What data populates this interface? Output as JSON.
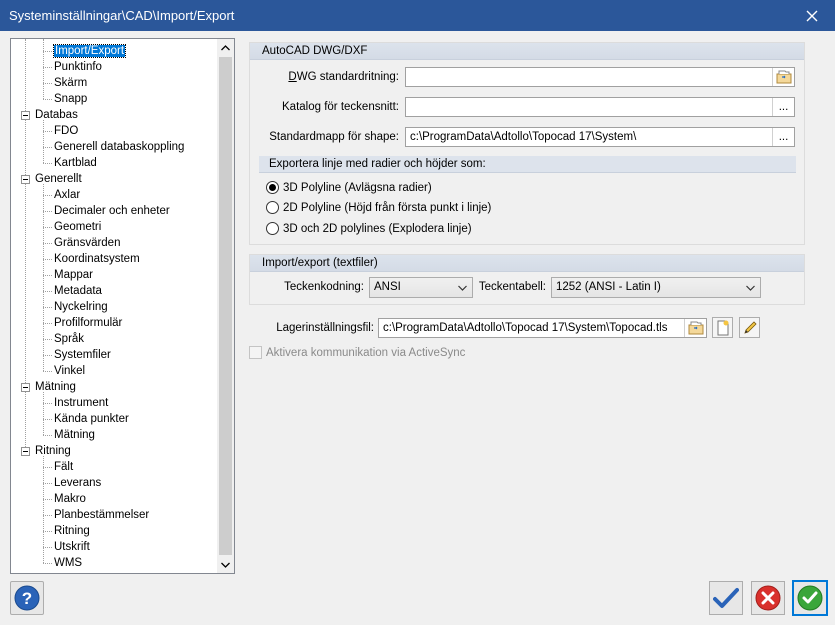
{
  "window": {
    "title": "Systeminställningar\\CAD\\Import/Export"
  },
  "tree": {
    "items": [
      {
        "label": "Import/Export",
        "level": 1,
        "selected": true
      },
      {
        "label": "Punktinfo",
        "level": 1
      },
      {
        "label": "Skärm",
        "level": 1
      },
      {
        "label": "Snapp",
        "level": 1
      },
      {
        "label": "Databas",
        "level": 0,
        "expandable": true
      },
      {
        "label": "FDO",
        "level": 1
      },
      {
        "label": "Generell databaskoppling",
        "level": 1
      },
      {
        "label": "Kartblad",
        "level": 1
      },
      {
        "label": "Generellt",
        "level": 0,
        "expandable": true
      },
      {
        "label": "Axlar",
        "level": 1
      },
      {
        "label": "Decimaler och enheter",
        "level": 1
      },
      {
        "label": "Geometri",
        "level": 1
      },
      {
        "label": "Gränsvärden",
        "level": 1
      },
      {
        "label": "Koordinatsystem",
        "level": 1
      },
      {
        "label": "Mappar",
        "level": 1
      },
      {
        "label": "Metadata",
        "level": 1
      },
      {
        "label": "Nyckelring",
        "level": 1
      },
      {
        "label": "Profilformulär",
        "level": 1
      },
      {
        "label": "Språk",
        "level": 1
      },
      {
        "label": "Systemfiler",
        "level": 1
      },
      {
        "label": "Vinkel",
        "level": 1
      },
      {
        "label": "Mätning",
        "level": 0,
        "expandable": true
      },
      {
        "label": "Instrument",
        "level": 1
      },
      {
        "label": "Kända punkter",
        "level": 1
      },
      {
        "label": "Mätning",
        "level": 1
      },
      {
        "label": "Ritning",
        "level": 0,
        "expandable": true
      },
      {
        "label": "Fält",
        "level": 1
      },
      {
        "label": "Leverans",
        "level": 1
      },
      {
        "label": "Makro",
        "level": 1
      },
      {
        "label": "Planbestämmelser",
        "level": 1
      },
      {
        "label": "Ritning",
        "level": 1
      },
      {
        "label": "Utskrift",
        "level": 1
      },
      {
        "label": "WMS",
        "level": 1
      }
    ]
  },
  "autocad": {
    "header": "AutoCAD DWG/DXF",
    "dwg_label": "DWG standardritning:",
    "dwg_value": "",
    "font_label": "Katalog för teckensnitt:",
    "font_value": "",
    "shape_label": "Standardmapp för shape:",
    "shape_value": "c:\\ProgramData\\Adtollo\\Topocad 17\\System\\",
    "browse_label": "...",
    "export_header": "Exportera linje med radier och höjder som:",
    "options": [
      {
        "label": "3D Polyline (Avlägsna radier)",
        "checked": true
      },
      {
        "label": "2D Polyline (Höjd från första punkt i linje)",
        "checked": false
      },
      {
        "label": "3D och 2D polylines (Explodera linje)",
        "checked": false
      }
    ]
  },
  "textfiles": {
    "header": "Import/export (textfiler)",
    "encoding_label": "Teckenkodning:",
    "encoding_value": "ANSI",
    "table_label": "Teckentabell:",
    "table_value": "1252  (ANSI - Latin I)"
  },
  "layer": {
    "label": "Lagerinställningsfil:",
    "value": "c:\\ProgramData\\Adtollo\\Topocad 17\\System\\Topocad.tls"
  },
  "activesync": {
    "label": "Aktivera kommunikation via ActiveSync",
    "checked": false,
    "enabled": false
  },
  "colors": {
    "titlebar": "#2b579a",
    "selection": "#0078d7",
    "group_header": "#dce3ec"
  }
}
